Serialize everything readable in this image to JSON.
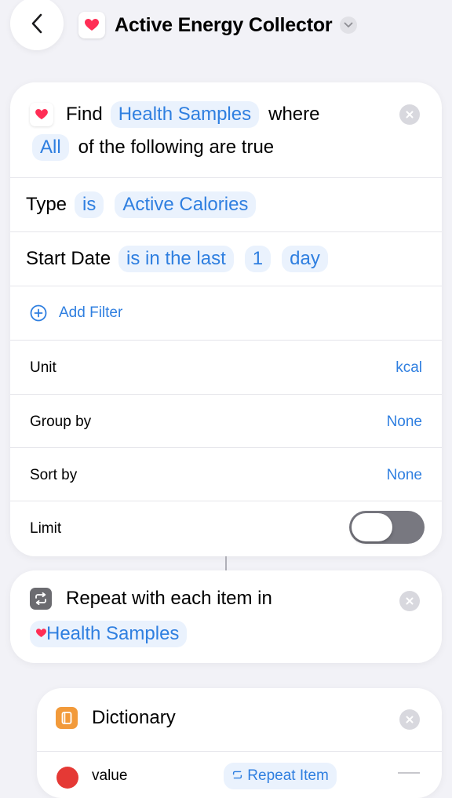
{
  "header": {
    "title": "Active Energy Collector"
  },
  "find_action": {
    "find_label": "Find",
    "entity_token": "Health Samples",
    "where_label": "where",
    "all_token": "All",
    "condition_text": "of the following are true",
    "filters": [
      {
        "field": "Type",
        "operator": "is",
        "value": "Active Calories"
      },
      {
        "field": "Start Date",
        "operator": "is in the last",
        "amount": "1",
        "unit": "day"
      }
    ],
    "add_filter_label": "Add Filter",
    "options": [
      {
        "label": "Unit",
        "value": "kcal"
      },
      {
        "label": "Group by",
        "value": "None"
      },
      {
        "label": "Sort by",
        "value": "None"
      }
    ],
    "limit": {
      "label": "Limit",
      "enabled": false
    }
  },
  "repeat_action": {
    "label": "Repeat with each item in",
    "token": "Health Samples"
  },
  "dictionary_action": {
    "label": "Dictionary",
    "row_key": "value",
    "row_value": "Repeat Item"
  },
  "colors": {
    "accent": "#2f7fe0",
    "background": "#f2f2f7",
    "heart": "#ff2d55",
    "repeat_icon": "#6b6b70",
    "dictionary_icon": "#f29a3a",
    "delete_red": "#e53935"
  }
}
